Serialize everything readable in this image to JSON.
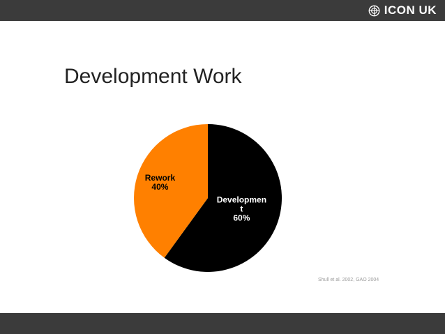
{
  "header": {
    "logo_text": "ICON UK",
    "logo_icon": "icon-uk-logo-icon"
  },
  "slide": {
    "title": "Development Work",
    "source": "Shull et al. 2002, GAO 2004"
  },
  "colors": {
    "bar": "#3b3b3b",
    "development": "#000000",
    "rework": "#ff8000"
  },
  "chart_data": {
    "type": "pie",
    "title": "",
    "slices": [
      {
        "label_lines": [
          "Developmen",
          "t"
        ],
        "value": 60,
        "value_label": "60%",
        "color": "#000000",
        "text_color": "#ffffff"
      },
      {
        "label_lines": [
          "Rework"
        ],
        "value": 40,
        "value_label": "40%",
        "color": "#ff8000",
        "text_color": "#000000"
      }
    ],
    "start_angle_deg": 0,
    "direction": "clockwise",
    "legend": "none"
  }
}
